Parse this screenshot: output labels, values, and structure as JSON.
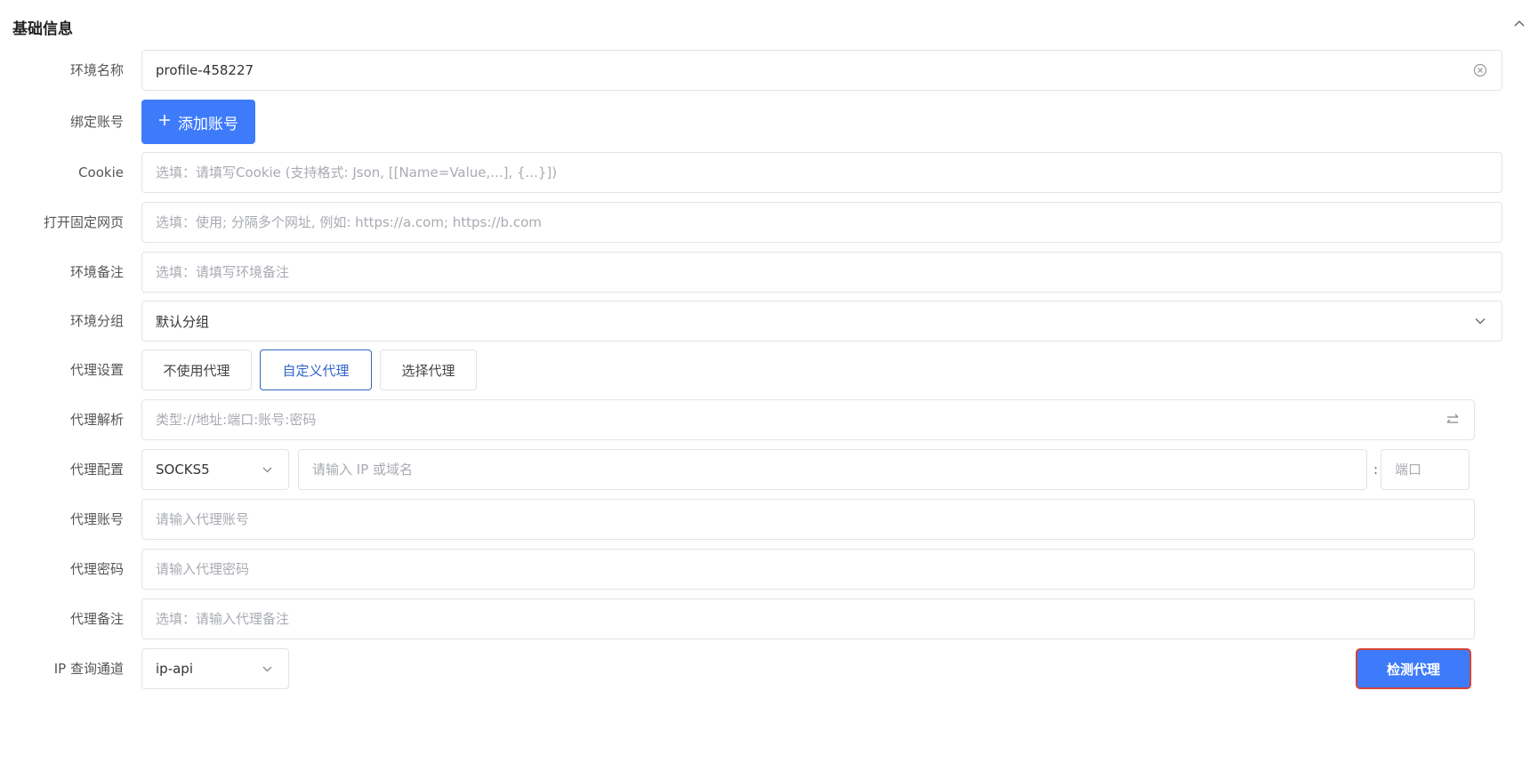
{
  "section": {
    "title": "基础信息"
  },
  "form": {
    "env_name": {
      "label": "环境名称",
      "value": "profile-458227"
    },
    "bind_account": {
      "label": "绑定账号",
      "button": "添加账号"
    },
    "cookie": {
      "label": "Cookie",
      "placeholder": "选填：请填写Cookie (支持格式: Json, [[Name=Value,...], {...}])"
    },
    "fixed_page": {
      "label": "打开固定网页",
      "placeholder": "选填：使用; 分隔多个网址, 例如: https://a.com; https://b.com"
    },
    "env_remark": {
      "label": "环境备注",
      "placeholder": "选填：请填写环境备注"
    },
    "env_group": {
      "label": "环境分组",
      "value": "默认分组"
    },
    "proxy_setting": {
      "label": "代理设置",
      "options": [
        "不使用代理",
        "自定义代理",
        "选择代理"
      ],
      "selected": "自定义代理"
    },
    "proxy_parse": {
      "label": "代理解析",
      "placeholder": "类型://地址:端口:账号:密码"
    },
    "proxy_config": {
      "label": "代理配置",
      "type": "SOCKS5",
      "host_placeholder": "请输入 IP 或域名",
      "colon": ":",
      "port_placeholder": "端口"
    },
    "proxy_account": {
      "label": "代理账号",
      "placeholder": "请输入代理账号"
    },
    "proxy_password": {
      "label": "代理密码",
      "placeholder": "请输入代理密码"
    },
    "proxy_remark": {
      "label": "代理备注",
      "placeholder": "选填：请输入代理备注"
    },
    "ip_channel": {
      "label": "IP 查询通道",
      "value": "ip-api",
      "check_button": "检测代理"
    }
  },
  "colors": {
    "primary": "#3e7bfa",
    "active_border": "#2f66c7",
    "highlight_border": "#d64338"
  },
  "icons": [
    "chevron-up-icon",
    "clear-icon",
    "plus-icon",
    "chevron-down-icon",
    "swap-icon"
  ]
}
